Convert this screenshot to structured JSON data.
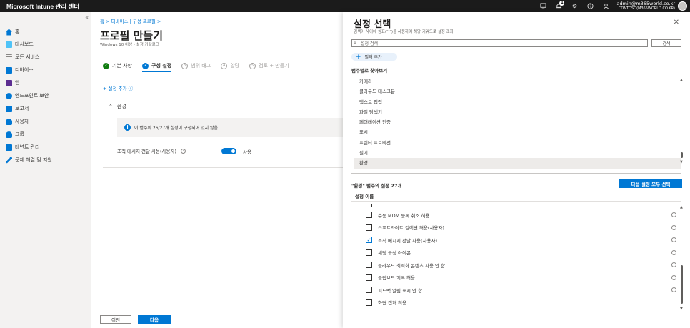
{
  "topbar": {
    "brand": "Microsoft Intune 관리 센터",
    "icons": [
      "screen-share-icon",
      "bell-icon",
      "gear-icon",
      "help-icon",
      "feedback-icon"
    ],
    "notification_count": "1",
    "user": "admin@m365world.co.kr",
    "tenant": "CONTOSO(M365WORLD.CO.KR)"
  },
  "leftnav": {
    "collapse_label": "«",
    "items": [
      {
        "label": "홈",
        "color": "#0078d4"
      },
      {
        "label": "대시보드",
        "color": "#4fc3f7"
      },
      {
        "label": "모든 서비스",
        "color": "#8a8886"
      },
      {
        "label": "디바이스",
        "color": "#0078d4"
      },
      {
        "label": "앱",
        "color": "#5c2d91"
      },
      {
        "label": "엔드포인트 보안",
        "color": "#0078d4"
      },
      {
        "label": "보고서",
        "color": "#0078d4"
      },
      {
        "label": "사용자",
        "color": "#0078d4"
      },
      {
        "label": "그룹",
        "color": "#0078d4"
      },
      {
        "label": "테넌트 관리",
        "color": "#0078d4"
      },
      {
        "label": "문제 해결 및 지원",
        "color": "#0078d4"
      }
    ]
  },
  "main": {
    "breadcrumb": "홈 > 디바이스 | 구성 프로필 >",
    "title": "프로필 만들기",
    "more": "…",
    "subtitle": "Windows 10 이상 - 설정 카탈로그",
    "steps": [
      {
        "num": "✓",
        "label": "기본 사항",
        "state": "done"
      },
      {
        "num": "2",
        "label": "구성 설정",
        "state": "active"
      },
      {
        "num": "3",
        "label": "범위 태그",
        "state": "pending"
      },
      {
        "num": "4",
        "label": "할당",
        "state": "pending"
      },
      {
        "num": "5",
        "label": "검토 + 만들기",
        "state": "pending"
      }
    ],
    "add_setting": "+ 설정 추가 ⓘ",
    "section_label": "환경",
    "info_text": "이 범주의 26/27개 설정이 구성되어 있지 않음",
    "setting_label": "조직 메시지 전달 사용(사용자)",
    "setting_value": "사용",
    "prev_label": "이전",
    "next_label": "다음"
  },
  "panel": {
    "title": "설정 선택",
    "description": "검색어 사이에 쉼표(\",\")를 사용하여 해당 키워드로 설정 조회",
    "search_placeholder": "설정 검색",
    "search_button": "검색",
    "filter_label": "필터 추가",
    "browse_label": "범주별로 찾아보기",
    "categories": [
      "카메라",
      "클라우드 데스크톱",
      "텍스트 입력",
      "파일 탐색기",
      "페더레이션 인증",
      "표시",
      "프린터 프로비전",
      "필기",
      "환경"
    ],
    "selected_category": "환경",
    "settings_header": "\"환경\" 범주의 설정 27개",
    "select_all_label": "다음 설정 모두 선택",
    "column_header": "설정 이름",
    "settings": [
      {
        "label": "수동 MDM 등록 취소 허용",
        "checked": false
      },
      {
        "label": "스포트라이트 컬렉션 허용(사용자)",
        "checked": false
      },
      {
        "label": "조직 메시지 전달 사용(사용자)",
        "checked": true
      },
      {
        "label": "채팅 구성 아이콘",
        "checked": false
      },
      {
        "label": "클라우드 최적화 콘텐츠 사용 안 함",
        "checked": false
      },
      {
        "label": "클립보드 기록 허용",
        "checked": false
      },
      {
        "label": "피드백 알림 표시 안 함",
        "checked": false
      },
      {
        "label": "화면 캡처 허용",
        "checked": false
      }
    ]
  }
}
